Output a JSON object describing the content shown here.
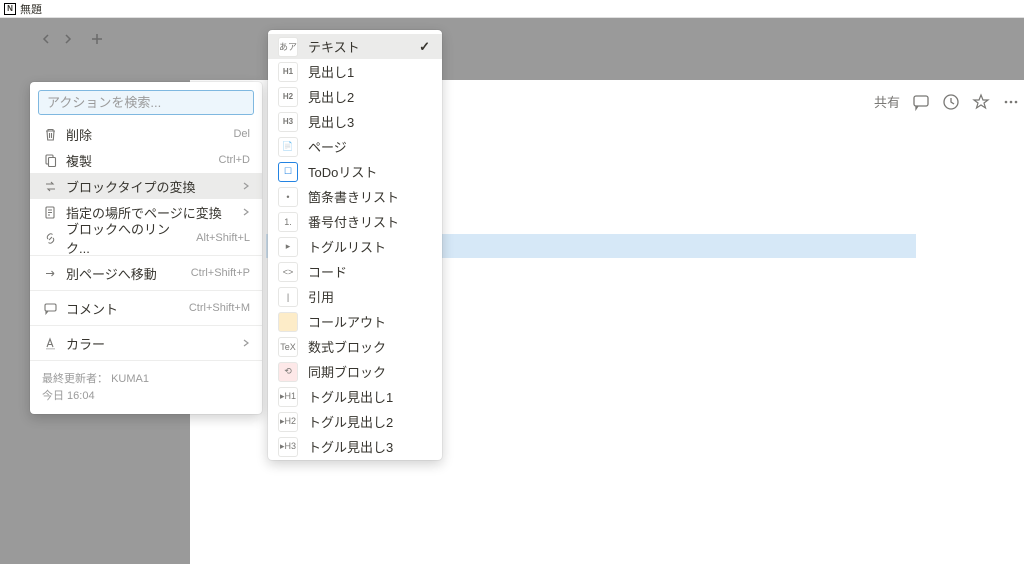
{
  "window": {
    "title": "無題"
  },
  "toolbar": {
    "share": "共有"
  },
  "context_menu": {
    "search_placeholder": "アクションを検索...",
    "items": [
      {
        "icon": "trash",
        "label": "削除",
        "shortcut": "Del"
      },
      {
        "icon": "copy",
        "label": "複製",
        "shortcut": "Ctrl+D"
      },
      {
        "icon": "transform",
        "label": "ブロックタイプの変換",
        "submenu": true,
        "active": true
      },
      {
        "icon": "page-arrow",
        "label": "指定の場所でページに変換",
        "submenu": true
      },
      {
        "icon": "link",
        "label": "ブロックへのリンク...",
        "shortcut": "Alt+Shift+L"
      }
    ],
    "items2": [
      {
        "icon": "move",
        "label": "別ページへ移動",
        "shortcut": "Ctrl+Shift+P"
      }
    ],
    "items3": [
      {
        "icon": "comment",
        "label": "コメント",
        "shortcut": "Ctrl+Shift+M"
      }
    ],
    "items4": [
      {
        "icon": "color",
        "label": "カラー",
        "submenu": true
      }
    ],
    "footer": {
      "last_edited_label": "最終更新者：",
      "last_edited_user": "KUMA1",
      "time": "今日 16:04"
    }
  },
  "submenu": {
    "items": [
      {
        "icon": "あア",
        "label": "テキスト",
        "checked": true,
        "cls": ""
      },
      {
        "icon": "H1",
        "label": "見出し1",
        "cls": "h1"
      },
      {
        "icon": "H2",
        "label": "見出し2",
        "cls": "h1"
      },
      {
        "icon": "H3",
        "label": "見出し3",
        "cls": "h1"
      },
      {
        "icon": "📄",
        "label": "ページ",
        "cls": ""
      },
      {
        "icon": "☐",
        "label": "ToDoリスト",
        "cls": "todo"
      },
      {
        "icon": "•",
        "label": "箇条書きリスト",
        "cls": ""
      },
      {
        "icon": "1.",
        "label": "番号付きリスト",
        "cls": ""
      },
      {
        "icon": "▸",
        "label": "トグルリスト",
        "cls": ""
      },
      {
        "icon": "<>",
        "label": "コード",
        "cls": ""
      },
      {
        "icon": "|",
        "label": "引用",
        "cls": ""
      },
      {
        "icon": " ",
        "label": "コールアウト",
        "cls": "callout"
      },
      {
        "icon": "TeX",
        "label": "数式ブロック",
        "cls": ""
      },
      {
        "icon": "⟲",
        "label": "同期ブロック",
        "cls": "sync"
      },
      {
        "icon": "▸H1",
        "label": "トグル見出し1",
        "cls": ""
      },
      {
        "icon": "▸H2",
        "label": "トグル見出し2",
        "cls": ""
      },
      {
        "icon": "▸H3",
        "label": "トグル見出し3",
        "cls": ""
      }
    ]
  }
}
